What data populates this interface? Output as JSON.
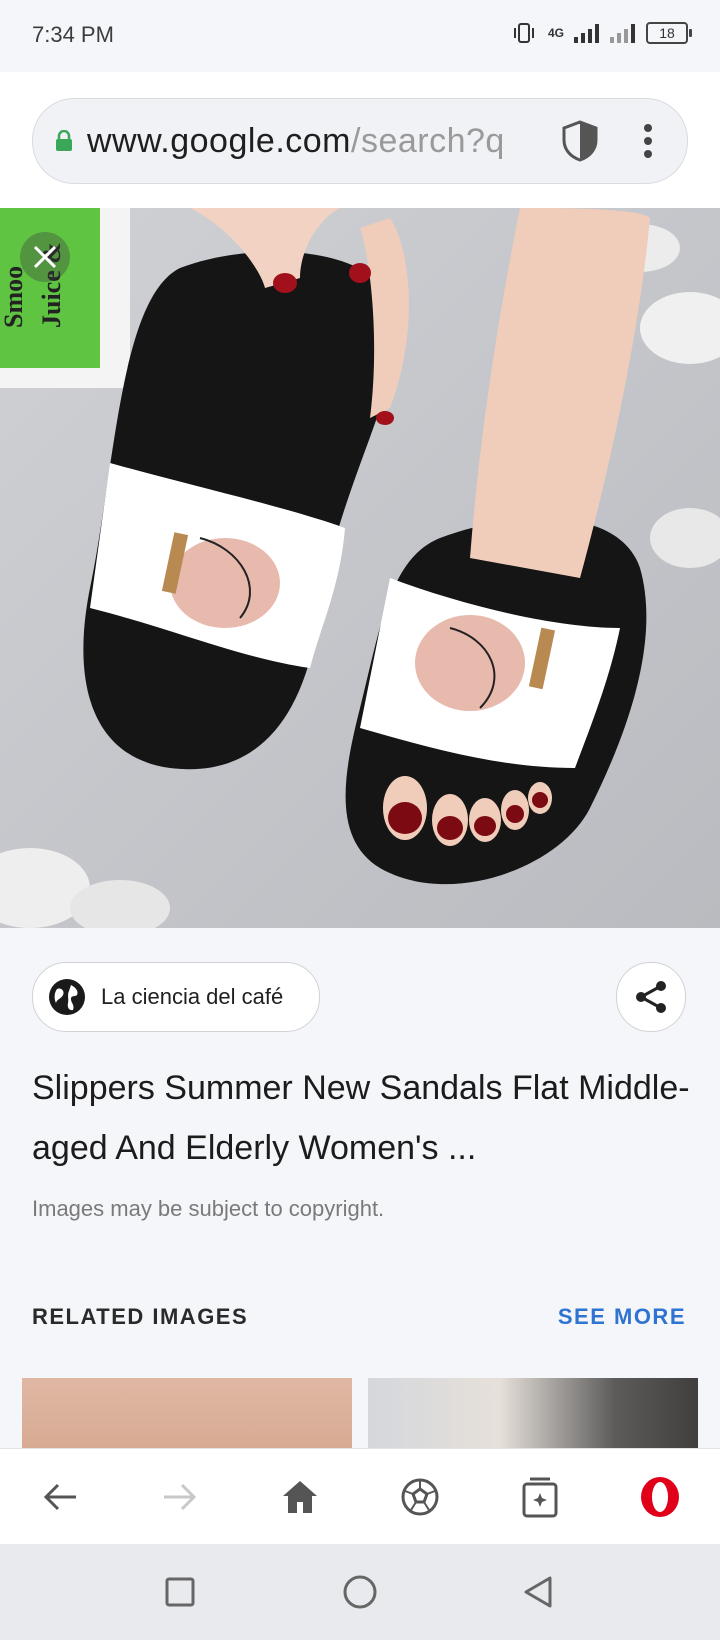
{
  "status_bar": {
    "time": "7:34 PM",
    "network": "4G",
    "battery": "18"
  },
  "address_bar": {
    "url_host": "www.google.com",
    "url_path": "/search?q"
  },
  "image_viewer": {
    "image_description": "Black slide sandals with white strap printed with pink ginkgo leaf design",
    "source_name": "La ciencia del café",
    "title": "Slippers Summer New Sandals Flat Middle-aged And Elderly Women's ...",
    "copyright_notice": "Images may be subject to copyright."
  },
  "related": {
    "heading": "RELATED IMAGES",
    "see_more": "SEE MORE"
  },
  "colors": {
    "accent": "#2f74d0",
    "opera_red": "#e0001a"
  }
}
